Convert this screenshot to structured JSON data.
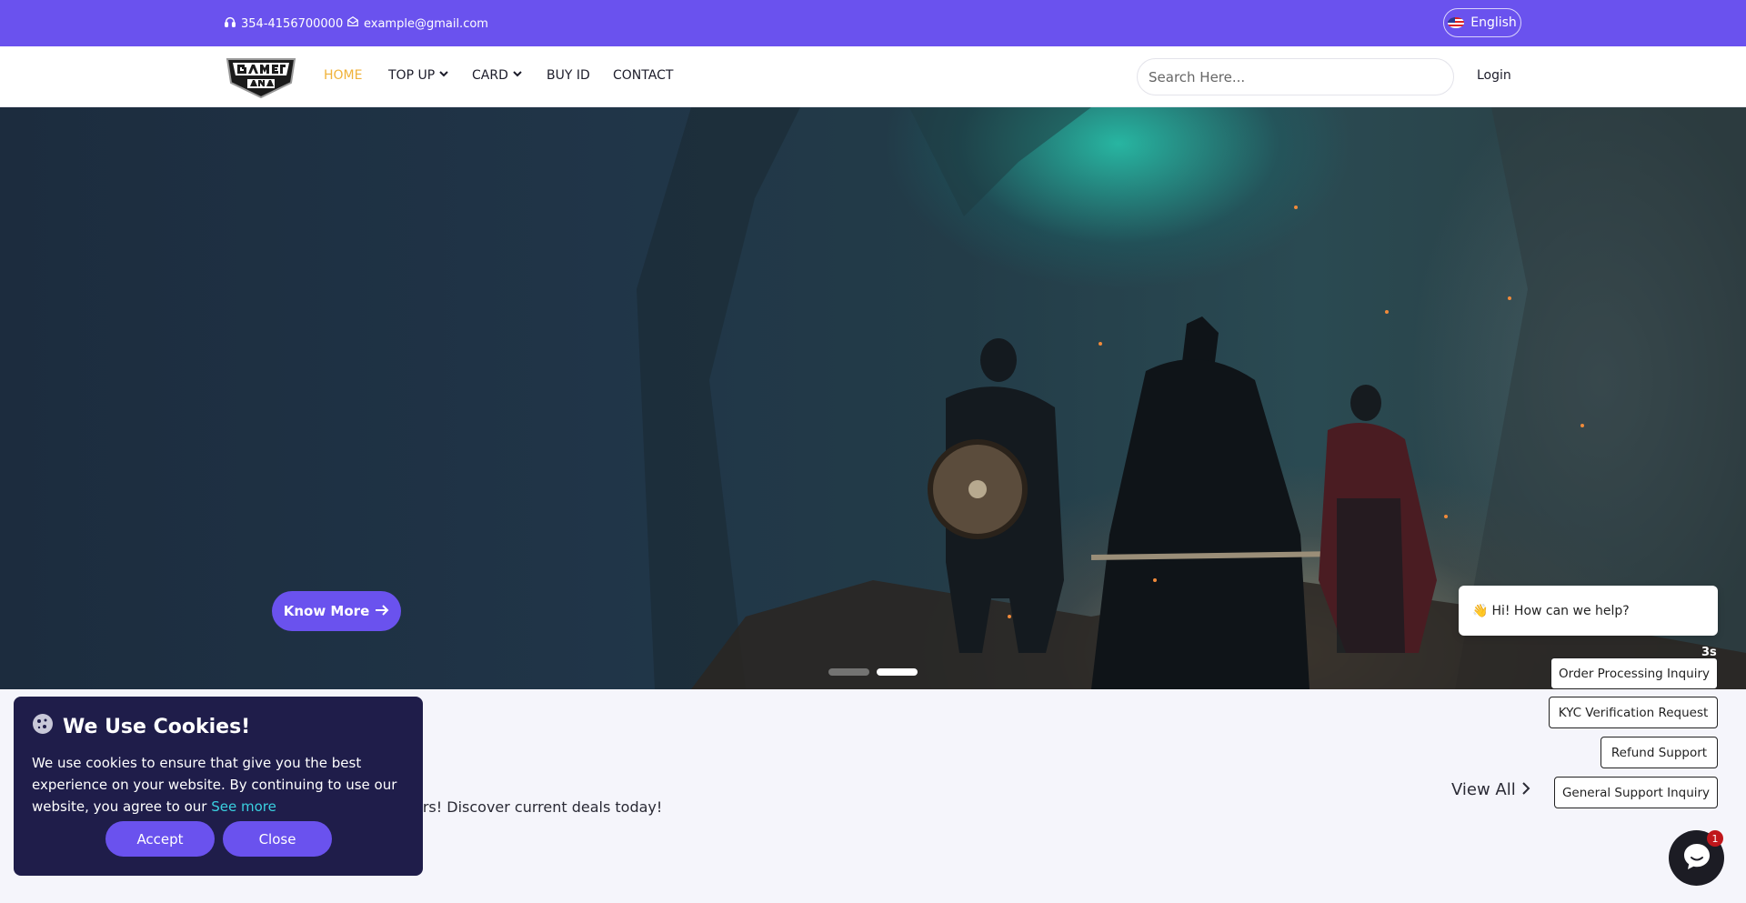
{
  "topbar": {
    "phone": "354-4156700000",
    "email": "example@gmail.com",
    "language": "English",
    "phone_icon": "headset-icon",
    "email_icon": "envelope-icon",
    "flag_icon": "us-flag-icon"
  },
  "nav": {
    "logo_icon": "gamers-arena-logo",
    "items": [
      {
        "label": "HOME",
        "active": true
      },
      {
        "label": "TOP UP",
        "dropdown": true
      },
      {
        "label": "CARD",
        "dropdown": true
      },
      {
        "label": "BUY ID"
      },
      {
        "label": "CONTACT"
      }
    ],
    "search_placeholder": "Search Here...",
    "login": "Login"
  },
  "hero": {
    "button": "Know More",
    "slides": 2,
    "active_slide": 2
  },
  "section": {
    "subtitle_fragment": "ers! Discover current deals today!",
    "view_all": "View All"
  },
  "cookie": {
    "title": "We Use Cookies!",
    "text": "We use cookies to ensure that give you the best experience on your website. By continuing to use our website, you agree to our",
    "link": "See more",
    "accept": "Accept",
    "close": "Close"
  },
  "chat": {
    "greeting": "Hi! How can we help?",
    "greeting_icon": "waving-hand-icon",
    "timer": "3s",
    "options": [
      "Order Processing Inquiry",
      "KYC Verification Request",
      "Refund Support",
      "General Support Inquiry"
    ],
    "badge_count": "1"
  },
  "colors": {
    "brand": "#6a52ee",
    "active_nav": "#f0b23a",
    "cookie_bg": "#1f1d4a",
    "badge": "#c0161b"
  }
}
